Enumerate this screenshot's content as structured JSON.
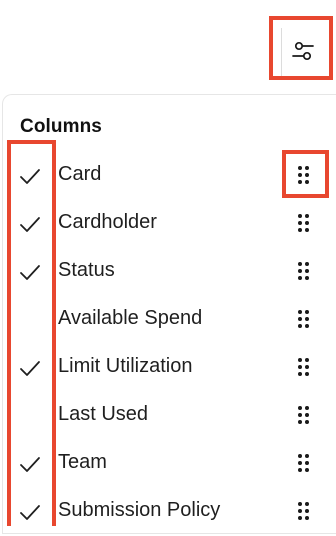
{
  "filter_button": {
    "icon": "sliders-icon"
  },
  "panel": {
    "title": "Columns",
    "columns": [
      {
        "label": "Card",
        "checked": true
      },
      {
        "label": "Cardholder",
        "checked": true
      },
      {
        "label": "Status",
        "checked": true
      },
      {
        "label": "Available Spend",
        "checked": false
      },
      {
        "label": "Limit Utilization",
        "checked": true
      },
      {
        "label": "Last Used",
        "checked": false
      },
      {
        "label": "Team",
        "checked": true
      },
      {
        "label": "Submission Policy",
        "checked": true
      }
    ]
  },
  "colors": {
    "highlight": "#e8472f",
    "text": "#1f1f1f"
  }
}
